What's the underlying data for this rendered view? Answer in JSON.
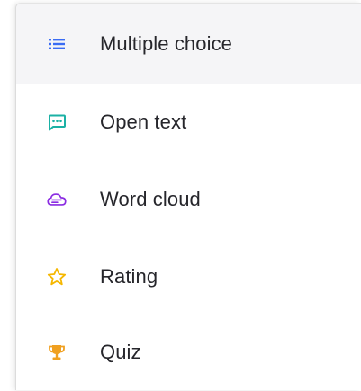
{
  "menu": {
    "items": [
      {
        "label": "Multiple choice",
        "icon": "list-icon",
        "color": "#3a6cf4"
      },
      {
        "label": "Open text",
        "icon": "chat-bubble-icon",
        "color": "#1bb1a5"
      },
      {
        "label": "Word cloud",
        "icon": "cloud-icon",
        "color": "#8a2be2"
      },
      {
        "label": "Rating",
        "icon": "star-icon",
        "color": "#f5b700"
      },
      {
        "label": "Quiz",
        "icon": "trophy-icon",
        "color": "#f0a020"
      }
    ]
  }
}
